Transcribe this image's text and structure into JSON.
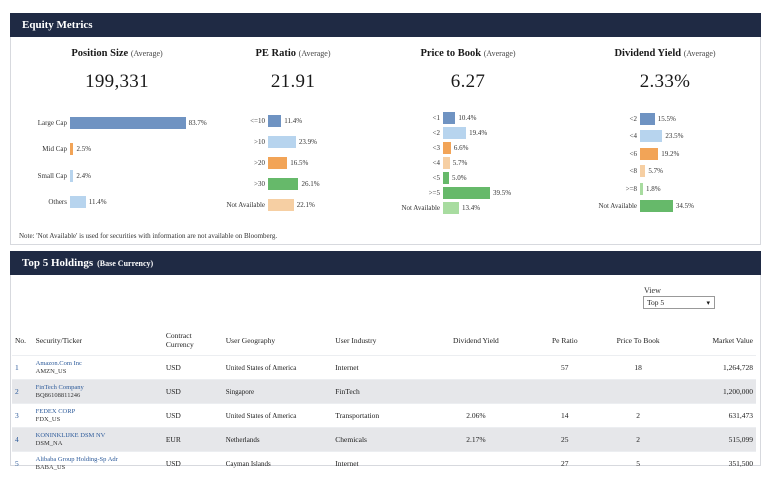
{
  "equity": {
    "header": "Equity Metrics",
    "note": "Note: 'Not Available' is used for securities with information are not available on Bloomberg.",
    "metrics": [
      {
        "title": "Position Size",
        "sub": "(Average)",
        "value": "199,331",
        "bars": [
          {
            "label": "Large Cap",
            "pct": "83.7%",
            "frac": 0.837,
            "color": "#6f93c2"
          },
          {
            "label": "Mid Cap",
            "pct": "2.5%",
            "frac": 0.025,
            "color": "#f2a457"
          },
          {
            "label": "Small Cap",
            "pct": "2.4%",
            "frac": 0.024,
            "color": "#b7d4ee"
          },
          {
            "label": "Others",
            "pct": "11.4%",
            "frac": 0.114,
            "color": "#b7d4ee"
          }
        ]
      },
      {
        "title": "PE Ratio",
        "sub": "(Average)",
        "value": "21.91",
        "bars": [
          {
            "label": "<=10",
            "pct": "11.4%",
            "frac": 0.114,
            "color": "#6f93c2"
          },
          {
            "label": ">10",
            "pct": "23.9%",
            "frac": 0.239,
            "color": "#b7d4ee"
          },
          {
            "label": ">20",
            "pct": "16.5%",
            "frac": 0.165,
            "color": "#f2a457"
          },
          {
            "label": ">30",
            "pct": "26.1%",
            "frac": 0.261,
            "color": "#66b96a"
          },
          {
            "label": "Not Available",
            "pct": "22.1%",
            "frac": 0.221,
            "color": "#f6cfa3"
          }
        ]
      },
      {
        "title": "Price to Book",
        "sub": "(Average)",
        "value": "6.27",
        "bars": [
          {
            "label": "<1",
            "pct": "10.4%",
            "frac": 0.104,
            "color": "#6f93c2"
          },
          {
            "label": "<2",
            "pct": "19.4%",
            "frac": 0.194,
            "color": "#b7d4ee"
          },
          {
            "label": "<3",
            "pct": "6.6%",
            "frac": 0.066,
            "color": "#f2a457"
          },
          {
            "label": "<4",
            "pct": "5.7%",
            "frac": 0.057,
            "color": "#f6cfa3"
          },
          {
            "label": "<5",
            "pct": "5.0%",
            "frac": 0.05,
            "color": "#66b96a"
          },
          {
            "label": ">=5",
            "pct": "39.5%",
            "frac": 0.395,
            "color": "#66b96a"
          },
          {
            "label": "Not Available",
            "pct": "13.4%",
            "frac": 0.134,
            "color": "#a8dca0"
          }
        ]
      },
      {
        "title": "Dividend Yield",
        "sub": "(Average)",
        "value": "2.33%",
        "bars": [
          {
            "label": "<2",
            "pct": "15.5%",
            "frac": 0.155,
            "color": "#6f93c2"
          },
          {
            "label": "<4",
            "pct": "23.5%",
            "frac": 0.235,
            "color": "#b7d4ee"
          },
          {
            "label": "<6",
            "pct": "19.2%",
            "frac": 0.192,
            "color": "#f2a457"
          },
          {
            "label": "<8",
            "pct": "5.7%",
            "frac": 0.057,
            "color": "#f6cfa3"
          },
          {
            "label": ">=8",
            "pct": "1.8%",
            "frac": 0.018,
            "color": "#a8dca0"
          },
          {
            "label": "Not Available",
            "pct": "34.5%",
            "frac": 0.345,
            "color": "#66b96a"
          }
        ]
      }
    ]
  },
  "holdings": {
    "header": "Top 5 Holdings",
    "header_sub": "(Base Currency)",
    "view_label": "View",
    "view_value": "Top 5",
    "columns": [
      "No.",
      "Security/Ticker",
      "Contract Currency",
      "User Geography",
      "User Industry",
      "Dividend Yield",
      "Pe Ratio",
      "Price To Book",
      "Market Value"
    ],
    "rows": [
      {
        "no": "1",
        "name": "Amazon.Com Inc",
        "ticker": "AMZN_US",
        "ccy": "USD",
        "geo": "United States of America",
        "industry": "Internet",
        "dy": "",
        "pe": "57",
        "pb": "18",
        "mv": "1,264,728"
      },
      {
        "no": "2",
        "name": "FinTech Company",
        "ticker": "BQ86108811246",
        "ccy": "USD",
        "geo": "Singapore",
        "industry": "FinTech",
        "dy": "",
        "pe": "",
        "pb": "",
        "mv": "1,200,000"
      },
      {
        "no": "3",
        "name": "FEDEX CORP",
        "ticker": "FDX_US",
        "ccy": "USD",
        "geo": "United States of America",
        "industry": "Transportation",
        "dy": "2.06%",
        "pe": "14",
        "pb": "2",
        "mv": "631,473"
      },
      {
        "no": "4",
        "name": "KONINKLIJKE DSM NV",
        "ticker": "DSM_NA",
        "ccy": "EUR",
        "geo": "Netherlands",
        "industry": "Chemicals",
        "dy": "2.17%",
        "pe": "25",
        "pb": "2",
        "mv": "515,099"
      },
      {
        "no": "5",
        "name": "Alibaba Group Holding-Sp Adr",
        "ticker": "BABA_US",
        "ccy": "USD",
        "geo": "Cayman Islands",
        "industry": "Internet",
        "dy": "",
        "pe": "27",
        "pb": "5",
        "mv": "351,500"
      }
    ]
  }
}
